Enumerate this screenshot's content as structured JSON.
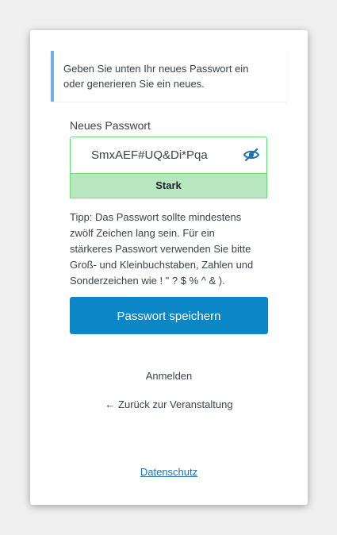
{
  "notice": {
    "line1": "Geben Sie unten Ihr neues Passwort ein",
    "line2": "oder generieren Sie ein neues."
  },
  "password": {
    "label": "Neues Passwort",
    "value": "SmxAEF#UQ&Di*Pqa",
    "visibility_icon": "eye-slash-icon",
    "strength_label": "Stark",
    "strength_color": "#b8e6bf",
    "strength_border_color": "#68de7c"
  },
  "hint": {
    "line1": "Tipp: Das Passwort sollte mindestens",
    "line2": "zwölf Zeichen lang sein. Für ein",
    "line3": "stärkeres Passwort verwenden Sie bitte",
    "line4": "Groß- und Kleinbuchstaben, Zahlen und",
    "line5": "Sonderzeichen wie ! \" ? $ % ^ & )."
  },
  "actions": {
    "save_label": "Passwort speichern",
    "save_color": "#0a87c4"
  },
  "links": {
    "login": "Anmelden",
    "back": "← Zurück zur Veranstaltung",
    "privacy": "Datenschutz"
  },
  "colors": {
    "notice_accent": "#72aee6",
    "link": "#2271b1",
    "background": "#f0f0f1"
  }
}
